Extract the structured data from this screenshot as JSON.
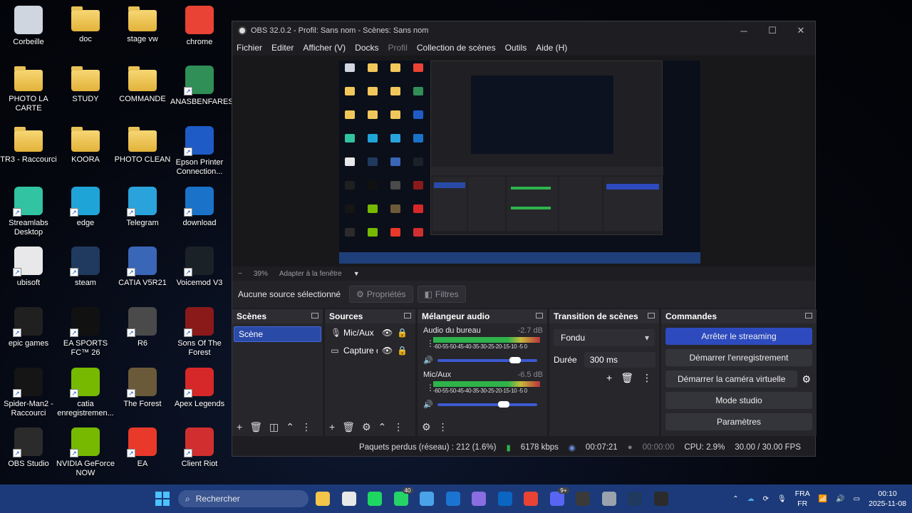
{
  "desktop": {
    "icons": [
      {
        "label": "Corbeille",
        "icon": "recycle-bin-icon",
        "color": "#cfd6e0"
      },
      {
        "label": "doc",
        "icon": "folder-icon",
        "color": "#f1c75b"
      },
      {
        "label": "stage vw",
        "icon": "folder-icon",
        "color": "#f1c75b"
      },
      {
        "label": "chrome",
        "icon": "chrome-icon",
        "color": "#e94335"
      },
      {
        "label": "PHOTO LA CARTE",
        "icon": "folder-icon",
        "color": "#f1c75b"
      },
      {
        "label": "STUDY",
        "icon": "folder-icon",
        "color": "#f1c75b"
      },
      {
        "label": "COMMANDE",
        "icon": "folder-icon",
        "color": "#f1c75b"
      },
      {
        "label": "ANASBENFARES",
        "icon": "qr-app-icon",
        "color": "#2f8f57"
      },
      {
        "label": "TR3 - Raccourci",
        "icon": "folder-icon",
        "color": "#f1c75b"
      },
      {
        "label": "KOORA",
        "icon": "folder-icon",
        "color": "#f1c75b"
      },
      {
        "label": "PHOTO CLEAN",
        "icon": "folder-icon",
        "color": "#f1c75b"
      },
      {
        "label": "Epson Printer Connection...",
        "icon": "printer-app-icon",
        "color": "#1e5bc6"
      },
      {
        "label": "Streamlabs Desktop",
        "icon": "streamlabs-icon",
        "color": "#31c3a2"
      },
      {
        "label": "edge",
        "icon": "edge-icon",
        "color": "#1fa4d8"
      },
      {
        "label": "Telegram",
        "icon": "telegram-icon",
        "color": "#2aa3dc"
      },
      {
        "label": "download",
        "icon": "download-app-icon",
        "color": "#1a73c9"
      },
      {
        "label": "ubisoft",
        "icon": "ubisoft-icon",
        "color": "#e8e8ea"
      },
      {
        "label": "steam",
        "icon": "steam-icon",
        "color": "#1f3a5e"
      },
      {
        "label": "CATIA V5R21",
        "icon": "catia-icon",
        "color": "#3a66b8"
      },
      {
        "label": "Voicemod V3",
        "icon": "voicemod-icon",
        "color": "#1a2228"
      },
      {
        "label": "epic games",
        "icon": "epic-games-icon",
        "color": "#202020"
      },
      {
        "label": "EA SPORTS FC™ 26",
        "icon": "ea-fc-icon",
        "color": "#111111"
      },
      {
        "label": "R6",
        "icon": "r6-icon",
        "color": "#4a4a4a"
      },
      {
        "label": "Sons Of The Forest",
        "icon": "sons-forest-icon",
        "color": "#8a1a1a"
      },
      {
        "label": "Spider-Man2 - Raccourci",
        "icon": "spiderman-icon",
        "color": "#151515"
      },
      {
        "label": "catia enregistremen...",
        "icon": "nvidia-icon",
        "color": "#76b900"
      },
      {
        "label": "The Forest",
        "icon": "the-forest-icon",
        "color": "#6b5a3a"
      },
      {
        "label": "Apex Legends",
        "icon": "apex-icon",
        "color": "#d62828"
      },
      {
        "label": "OBS Studio",
        "icon": "obs-icon",
        "color": "#2b2b2b"
      },
      {
        "label": "NVIDIA GeForce NOW",
        "icon": "nvidia-icon",
        "color": "#76b900"
      },
      {
        "label": "EA",
        "icon": "ea-icon",
        "color": "#e8392a"
      },
      {
        "label": "Client Riot",
        "icon": "riot-icon",
        "color": "#d12f2f"
      }
    ]
  },
  "obs": {
    "title": "OBS 32.0.2 - Profil: Sans nom - Scènes: Sans nom",
    "menu": [
      "Fichier",
      "Editer",
      "Afficher (V)",
      "Docks",
      "Profil",
      "Collection de scènes",
      "Outils",
      "Aide (H)"
    ],
    "zoom": {
      "minus": "−",
      "value": "39%",
      "fit": "Adapter à la fenêtre"
    },
    "source_bar": {
      "status": "Aucune source sélectionné",
      "properties": "Propriétés",
      "filters": "Filtres"
    },
    "scenes": {
      "title": "Scènes",
      "items": [
        "Scène"
      ]
    },
    "sources": {
      "title": "Sources",
      "items": [
        "Mic/Aux",
        "Capture d"
      ]
    },
    "mixer": {
      "title": "Mélangeur audio",
      "channels": [
        {
          "name": "Audio du bureau",
          "db": "-2.7 dB",
          "volume": 0.84
        },
        {
          "name": "Mic/Aux",
          "db": "-6.5 dB",
          "volume": 0.72
        }
      ],
      "scale": "-60-55-50-45-40-35-30-25-20-15-10 -5 0"
    },
    "transitions": {
      "title": "Transition de scènes",
      "selected": "Fondu",
      "duration_label": "Durée",
      "duration_value": "300 ms"
    },
    "commands": {
      "title": "Commandes",
      "buttons": [
        "Arrêter le streaming",
        "Démarrer l'enregistrement",
        "Démarrer la caméra virtuelle",
        "Mode studio",
        "Paramètres"
      ]
    },
    "status": {
      "dropped": "Paquets perdus (réseau) : 212 (1.6%)",
      "bitrate": "6178 kbps",
      "stream_time": "00:07:21",
      "rec_time": "00:00:00",
      "cpu": "CPU: 2.9%",
      "fps": "30.00 / 30.00 FPS"
    }
  },
  "taskbar": {
    "search_placeholder": "Rechercher",
    "apps": [
      {
        "icon": "file-explorer-icon",
        "color": "#f3c54a"
      },
      {
        "icon": "ms-store-icon",
        "color": "#e8e8e8"
      },
      {
        "icon": "spotify-icon",
        "color": "#1ed760"
      },
      {
        "icon": "whatsapp-icon",
        "color": "#25d366",
        "badge": "40"
      },
      {
        "icon": "photos-icon",
        "color": "#4aa3e8"
      },
      {
        "icon": "outlook-icon",
        "color": "#1b74d1"
      },
      {
        "icon": "gamepad-icon",
        "color": "#8a6de0"
      },
      {
        "icon": "linkedin-icon",
        "color": "#0a66c2"
      },
      {
        "icon": "chrome-icon",
        "color": "#e94335"
      },
      {
        "icon": "discord-icon",
        "color": "#5865f2",
        "badge": "9+"
      },
      {
        "icon": "obs-taskbar-icon",
        "color": "#3a3a3a"
      },
      {
        "icon": "settings-icon",
        "color": "#9aa3ad"
      },
      {
        "icon": "steam-icon",
        "color": "#1f3a5e"
      },
      {
        "icon": "game-app-icon",
        "color": "#2b2b2b"
      }
    ],
    "lang": "FRA",
    "lang_sub": "FR",
    "time": "00:10",
    "date": "2025-11-08"
  }
}
